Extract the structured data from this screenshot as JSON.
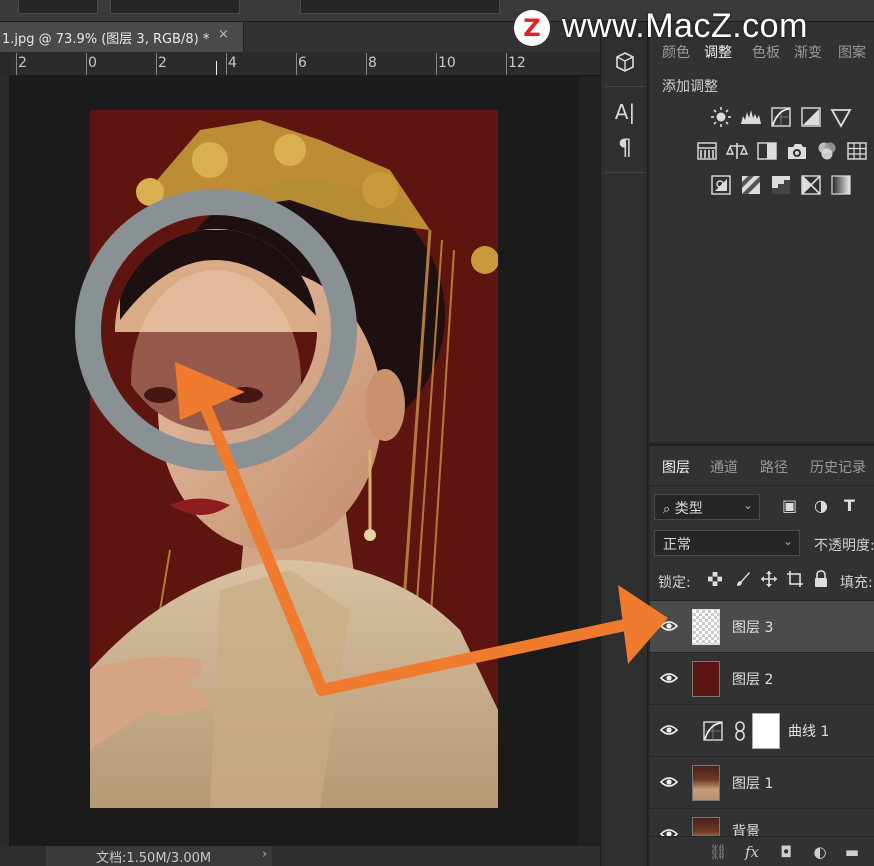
{
  "document": {
    "tab_title": "1.jpg @ 73.9% (图层 3, RGB/8) *",
    "close_glyph": "×",
    "status": "文档:1.50M/3.00M",
    "status_arrow": "›"
  },
  "ruler": {
    "labels": [
      "2",
      "0",
      "2",
      "4",
      "6",
      "8",
      "10",
      "12"
    ]
  },
  "tools": {
    "items": [
      {
        "name": "3d-cube-icon",
        "glyph": "⬢"
      },
      {
        "name": "character-panel-icon",
        "glyph": "A|"
      },
      {
        "name": "paragraph-panel-icon",
        "glyph": "¶"
      }
    ]
  },
  "adjustments": {
    "tabs": [
      "颜色",
      "调整",
      "色板",
      "渐变",
      "图案"
    ],
    "active_tab": "调整",
    "title": "添加调整"
  },
  "layers_panel": {
    "tabs": [
      "图层",
      "通道",
      "路径",
      "历史记录"
    ],
    "active_tab": "图层",
    "filter": {
      "label": "类型",
      "chevron": "⌄"
    },
    "filter_icon_glyphs": [
      "▣",
      "◑",
      "T"
    ],
    "blend_mode": "正常",
    "opacity_label": "不透明度:",
    "lock_label": "锁定:",
    "fill_label": "填充:",
    "layers": [
      {
        "name": "图层 3",
        "selected": true
      },
      {
        "name": "图层 2",
        "selected": false
      },
      {
        "name": "曲线 1",
        "selected": false
      },
      {
        "name": "图层 1",
        "selected": false
      },
      {
        "name": "背景",
        "selected": false
      }
    ],
    "footer_glyphs": [
      "⛓",
      "fx",
      "◘",
      "◐",
      "▬"
    ]
  },
  "watermark": {
    "logo_letter": "Z",
    "text": "www.MacZ.com"
  },
  "colors": {
    "accent_arrow": "#f07a2e",
    "photo_bg": "#5e1510",
    "ring_gray": "#8a9194",
    "ring_skin": "#d9ab87",
    "ring_red": "#5c1510"
  }
}
